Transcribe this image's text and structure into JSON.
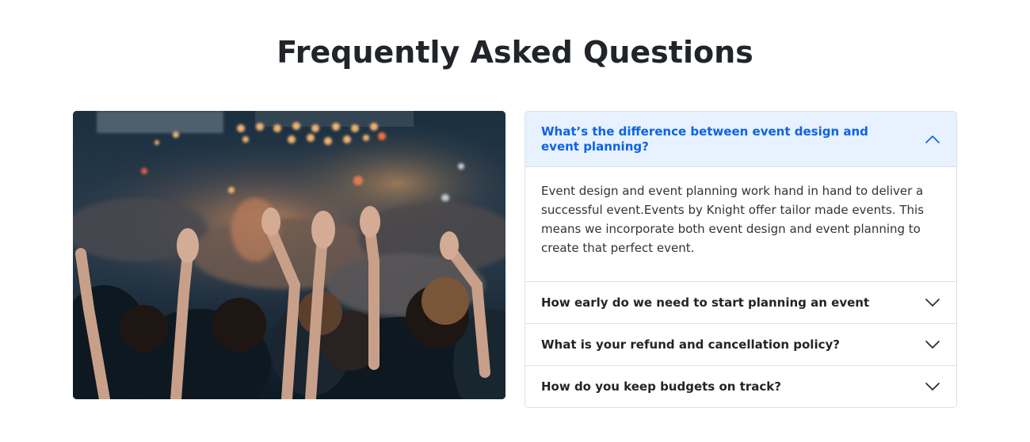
{
  "page": {
    "title": "Frequently Asked Questions"
  },
  "image": {
    "subject": "concert-crowd-photo"
  },
  "faq": {
    "items": [
      {
        "question": "What’s the difference between event design and event planning?",
        "answer": "Event design and event planning work hand in hand to deliver a successful event.Events by Knight offer tailor made events. This means we incorporate both event design and event planning to create that perfect event.",
        "expanded": true
      },
      {
        "question": "How early do we need to start planning an event",
        "expanded": false
      },
      {
        "question": "What is your refund and cancellation policy?",
        "expanded": false
      },
      {
        "question": "How do you keep budgets on track?",
        "expanded": false
      }
    ]
  },
  "colors": {
    "active_text": "#0c63e4",
    "active_bg": "#e7f1ff",
    "border": "#dee2e6",
    "heading": "#212529"
  },
  "icons": {
    "expanded": "chevron-up-icon",
    "collapsed": "chevron-down-icon"
  }
}
